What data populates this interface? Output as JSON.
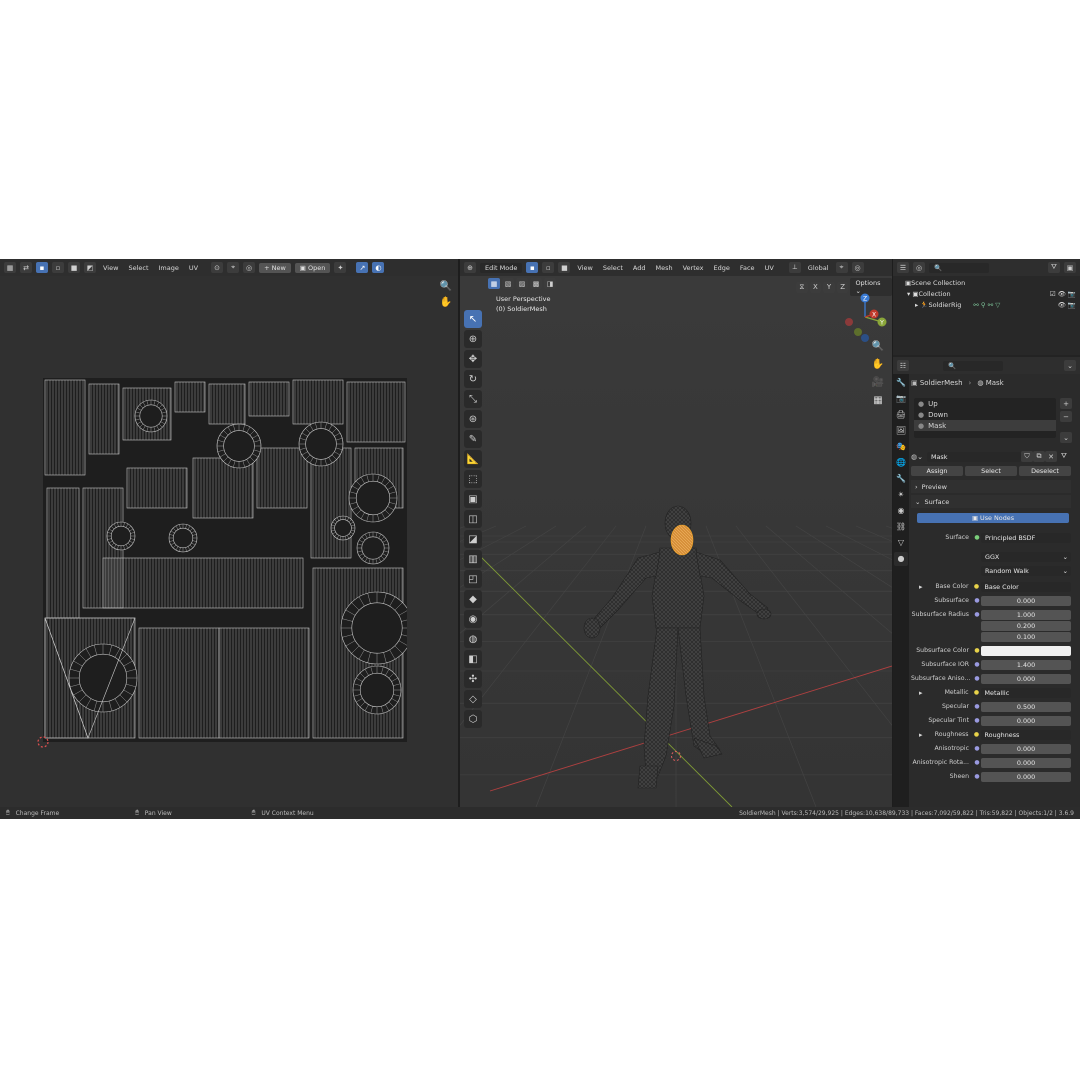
{
  "uv_editor": {
    "menus": [
      "View",
      "Select",
      "Image",
      "UV"
    ],
    "new_label": "New",
    "open_label": "Open"
  },
  "viewport": {
    "mode": "Edit Mode",
    "menus": [
      "View",
      "Select",
      "Add",
      "Mesh",
      "Vertex",
      "Edge",
      "Face",
      "UV"
    ],
    "transform_orientation": "Global",
    "axes": [
      "X",
      "Y",
      "Z"
    ],
    "options_label": "Options",
    "perspective_label": "User Perspective",
    "object_label": "(0) SoldierMesh",
    "gizmo_labels": {
      "x": "X",
      "y": "Y",
      "z": "Z"
    }
  },
  "outliner": {
    "scene_collection": "Scene Collection",
    "collection": "Collection",
    "object": "SoldierRig"
  },
  "properties": {
    "breadcrumb_object": "SoldierMesh",
    "breadcrumb_material": "Mask",
    "material_slots": [
      "Up",
      "Down",
      "Mask"
    ],
    "active_slot": "Mask",
    "material_name": "Mask",
    "assign_label": "Assign",
    "select_label": "Select",
    "deselect_label": "Deselect",
    "preview_label": "Preview",
    "surface_section": "Surface",
    "use_nodes_label": "Use Nodes",
    "surface_label": "Surface",
    "surface_shader": "Principled BSDF",
    "distribution": "GGX",
    "subsurface_method": "Random Walk",
    "rows": [
      {
        "label": "Base Color",
        "value": "Base Color",
        "kind": "link"
      },
      {
        "label": "Subsurface",
        "value": "0.000",
        "kind": "num"
      },
      {
        "label": "Subsurface Radius",
        "value": "1.000",
        "kind": "num"
      },
      {
        "label": "",
        "value": "0.200",
        "kind": "num"
      },
      {
        "label": "",
        "value": "0.100",
        "kind": "num"
      },
      {
        "label": "Subsurface Color",
        "value": "",
        "kind": "color"
      },
      {
        "label": "Subsurface IOR",
        "value": "1.400",
        "kind": "num"
      },
      {
        "label": "Subsurface Aniso...",
        "value": "0.000",
        "kind": "num"
      },
      {
        "label": "Metallic",
        "value": "Metallic",
        "kind": "link"
      },
      {
        "label": "Specular",
        "value": "0.500",
        "kind": "num"
      },
      {
        "label": "Specular Tint",
        "value": "0.000",
        "kind": "num"
      },
      {
        "label": "Roughness",
        "value": "Roughness",
        "kind": "link"
      },
      {
        "label": "Anisotropic",
        "value": "0.000",
        "kind": "num"
      },
      {
        "label": "Anisotropic Rota...",
        "value": "0.000",
        "kind": "num"
      },
      {
        "label": "Sheen",
        "value": "0.000",
        "kind": "num"
      }
    ],
    "specular_fill": 0.5,
    "subsurface_ior_fill": 0.05
  },
  "status": {
    "change_frame": "Change Frame",
    "pan_view": "Pan View",
    "uv_context_menu": "UV Context Menu",
    "stats": "SoldierMesh | Verts:3,574/29,925 | Edges:10,638/89,733 | Faces:7,092/59,822 | Tris:59,822 | Objects:1/2 | 3.6.9"
  },
  "colors": {
    "accent": "#4772b3",
    "selection": "#f5a623",
    "x_axis": "#c0392b",
    "y_axis": "#8aa63a",
    "z_axis": "#3a7bd5"
  }
}
